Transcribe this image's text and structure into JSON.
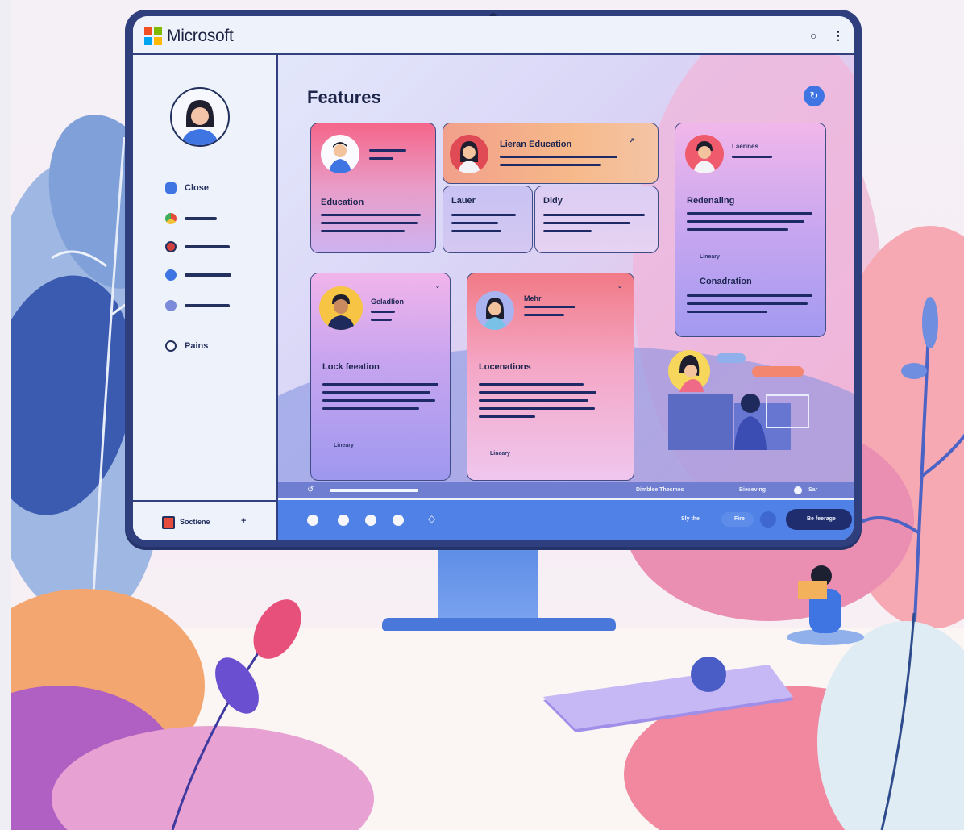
{
  "app": {
    "brand": "Microsoft",
    "brand_colors": [
      "#f25022",
      "#7fba00",
      "#00a4ef",
      "#ffb900"
    ],
    "titlebar_icons": [
      "circle-icon",
      "more-vertical-icon"
    ]
  },
  "sidebar": {
    "items": [
      {
        "label": "Close",
        "icon": "user-icon"
      },
      {
        "label": "",
        "icon": "chrome-icon"
      },
      {
        "label": "",
        "icon": "globe-icon"
      },
      {
        "label": "",
        "icon": "info-icon"
      },
      {
        "label": "",
        "icon": "settings-icon"
      },
      {
        "label": "Pains",
        "icon": "help-icon"
      }
    ],
    "footer_label": "Soctiene",
    "footer_extra": "+"
  },
  "main": {
    "title": "Features",
    "cards": [
      {
        "heading": "Education"
      },
      {
        "heading": "Lieran Education"
      },
      {
        "heading": "Lauer"
      },
      {
        "heading": "Didy"
      },
      {
        "heading": "Laerines",
        "subheading": "Redenaling",
        "footer": "Lineary",
        "section": "Conadration"
      },
      {
        "heading": "Geladlion",
        "subheading": "Lock feeation",
        "footer": "Lineary"
      },
      {
        "heading": "Mehr",
        "subheading": "Locenations",
        "footer": "Lineary"
      }
    ],
    "bottom_bar": {
      "left_items": [
        "",
        ""
      ],
      "right_items": [
        "Dimblee Thesmes",
        "Bieseving",
        "Sar"
      ]
    }
  },
  "taskbar": {
    "right_labels": [
      "Sly the",
      "Fire"
    ],
    "action_button": "Be feerage"
  },
  "colors": {
    "frame": "#2f3f7e",
    "accent": "#3f74e3",
    "taskbar": "#4f81e6"
  }
}
